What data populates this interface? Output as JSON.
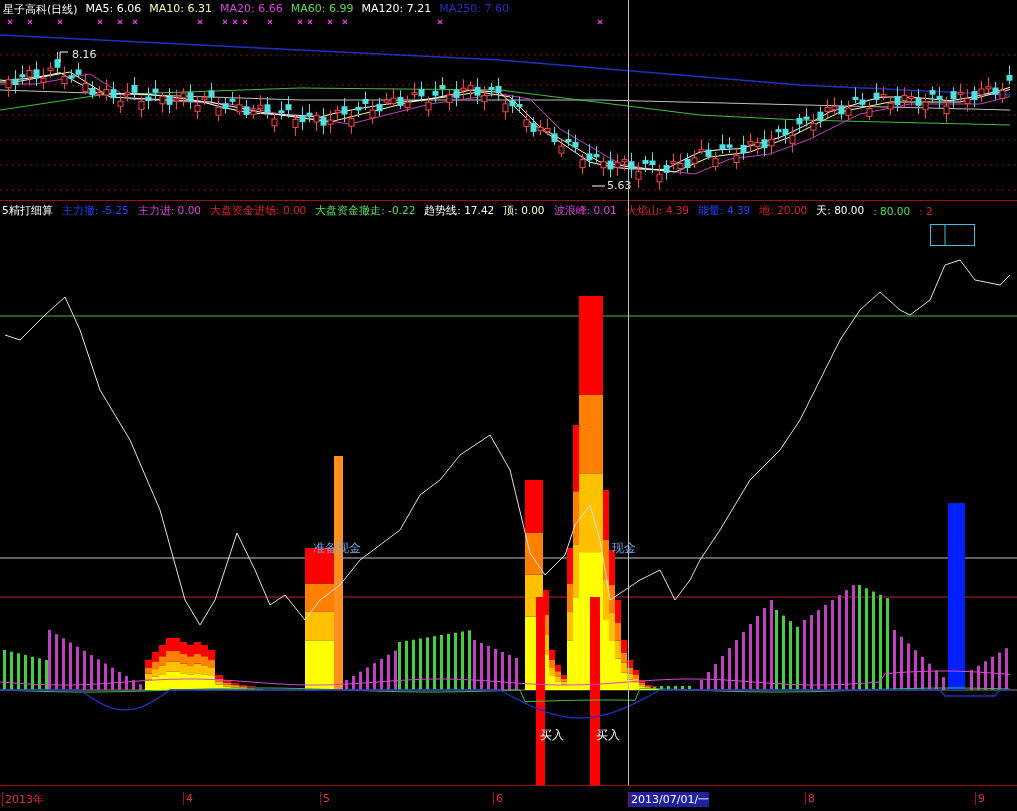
{
  "quote": {
    "title": "星子高科(日线)",
    "ma": [
      {
        "label": "MA5: 6.06",
        "color": "#ffffff"
      },
      {
        "label": "MA10: 6.31",
        "color": "#ffffa0"
      },
      {
        "label": "MA20: 6.66",
        "color": "#e040e0"
      },
      {
        "label": "MA60: 6.99",
        "color": "#50e050"
      },
      {
        "label": "MA120: 7.21",
        "color": "#ffffff"
      },
      {
        "label": "MA250: 7.60",
        "color": "#2030c0"
      }
    ]
  },
  "price_marks": [
    {
      "text": "8.16"
    },
    {
      "text": "5.63"
    }
  ],
  "indicator": {
    "items": [
      {
        "label": "5精打细算",
        "color": "#ffffff"
      },
      {
        "label": "主力撤: -5.25",
        "color": "#2040ff"
      },
      {
        "label": "主力进: 0.00",
        "color": "#e040e0"
      },
      {
        "label": "大盘资金进场: 0.00",
        "color": "#e02020"
      },
      {
        "label": "大盘资金撤走: -0.22",
        "color": "#50e050"
      },
      {
        "label": "趋势线: 17.42",
        "color": "#ffffff"
      },
      {
        "label": "顶: 0.00",
        "color": "#ffffd0"
      },
      {
        "label": "波浪峰: 0.01",
        "color": "#e040e0"
      },
      {
        "label": "火焰山: 4.39",
        "color": "#e02020"
      },
      {
        "label": "能量: 4.39",
        "color": "#2040ff"
      },
      {
        "label": "地: 20.00",
        "color": "#e02020"
      },
      {
        "label": "天: 80.00",
        "color": "#ffffff"
      },
      {
        "label": ": 80.00",
        "color": "#50e050"
      },
      {
        "label": ": 2",
        "color": "#e02020"
      }
    ]
  },
  "signals": [
    {
      "text": "准备现金"
    },
    {
      "text": "现金"
    }
  ],
  "buys": [
    {
      "text": "买入"
    },
    {
      "text": "买入"
    }
  ],
  "axis": [
    {
      "label": "2013年",
      "selected": false
    },
    {
      "label": "4",
      "selected": false
    },
    {
      "label": "5",
      "selected": false
    },
    {
      "label": "6",
      "selected": false
    },
    {
      "label": "2013/07/01/一",
      "selected": true
    },
    {
      "label": "8",
      "selected": false
    },
    {
      "label": "9",
      "selected": false
    }
  ]
}
